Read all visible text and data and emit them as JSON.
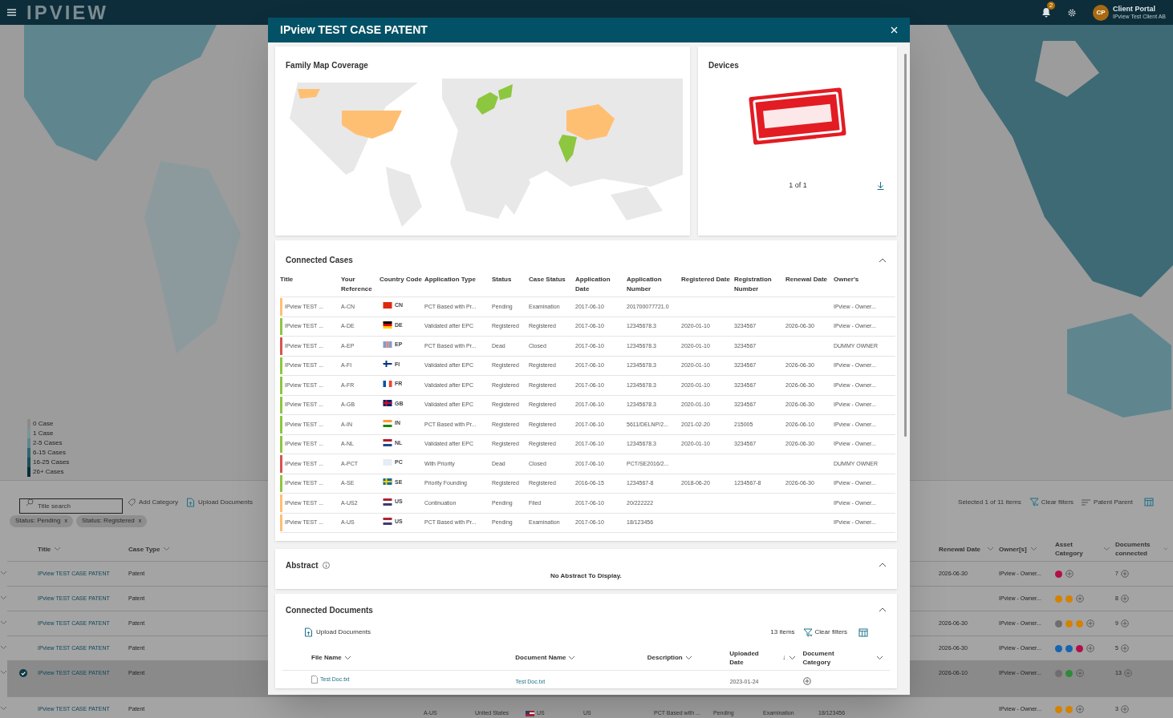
{
  "topbar": {
    "logo": "IPVIEW",
    "notification_count": "2",
    "avatar": "CP",
    "portal_title": "Client Portal",
    "client_name": "IPview Test Client AB"
  },
  "map_legend": [
    {
      "label": "0 Case",
      "color": "#8a8a8a"
    },
    {
      "label": "1 Case",
      "color": "#7d9398"
    },
    {
      "label": "2-5 Cases",
      "color": "#5f868e"
    },
    {
      "label": "6-15 Cases",
      "color": "#2f6470"
    },
    {
      "label": "16-25 Cases",
      "color": "#1a4d5a"
    },
    {
      "label": "26+ Cases",
      "color": "#062e38"
    }
  ],
  "toolbar": {
    "search_placeholder": "Title search",
    "add_category": "Add Category",
    "upload": "Upload Documents",
    "selection": "Selected 1 of 11 items",
    "clear_filters": "Clear filters",
    "view": "Patent Parent"
  },
  "filter_chips": [
    {
      "label": "Status: Pending",
      "remove": "x"
    },
    {
      "label": "Status: Registered",
      "remove": "x"
    }
  ],
  "case_table": {
    "columns": [
      "Title",
      "Case Type",
      "Renewal Date",
      "Owner[s]",
      "Asset Category",
      "Documents connected"
    ],
    "rows": [
      {
        "title": "IPview TEST CASE PATENT",
        "case_type": "Patent",
        "renewal_date": "2026-06-30",
        "owners": "IPview - Owner...",
        "asset_categories": [
          {
            "color": "#b0104a"
          }
        ],
        "documents": "7",
        "selected": false
      },
      {
        "title": "IPview TEST CASE PATENT",
        "case_type": "Patent",
        "owners": "IPview - Owner...",
        "asset_categories": [
          {
            "color": "#d48200"
          },
          {
            "color": "#d48200"
          }
        ],
        "documents": "8",
        "selected": false
      },
      {
        "title": "IPview TEST CASE PATENT",
        "case_type": "Patent",
        "renewal_date": "2026-06-30",
        "owners": "IPview - Owner...",
        "asset_categories": [
          {
            "color": "#6e6e6e"
          },
          {
            "color": "#d48200"
          },
          {
            "color": "#d48200"
          }
        ],
        "documents": "9",
        "selected": false
      },
      {
        "title": "IPview TEST CASE PATENT",
        "case_type": "Patent",
        "renewal_date": "2026-06-30",
        "owners": "IPview - Owner...",
        "asset_categories": [
          {
            "color": "#1565b0"
          },
          {
            "color": "#1565b0"
          },
          {
            "color": "#b0104a"
          }
        ],
        "documents": "5",
        "selected": false
      },
      {
        "title": "IPview TEST CASE PATENT",
        "case_type": "Patent",
        "renewal_date": "2026-06-10",
        "owners": "IPview - Owner...",
        "asset_categories": [
          {
            "color": "#6e6e6e"
          },
          {
            "color": "#2e8b3a"
          }
        ],
        "documents": "13",
        "selected": true
      },
      {
        "title": "IPview TEST CASE PATENT",
        "case_type": "Patent",
        "owners": "IPview - Owner...",
        "asset_categories": [
          {
            "color": "#d48200"
          },
          {
            "color": "#d48200"
          }
        ],
        "documents": "3",
        "selected": false,
        "middle_cells": [
          "A-US",
          "United States",
          "US",
          "US",
          "PCT Based with ...",
          "Pending",
          "Examination",
          "18/123456"
        ]
      }
    ]
  },
  "dialog": {
    "title": "IPview TEST CASE PATENT",
    "family_map": {
      "title": "Family Map Coverage"
    },
    "devices": {
      "title": "Devices",
      "pager": "1 of 1"
    },
    "connected_cases": {
      "title": "Connected Cases",
      "expanded": true,
      "columns": [
        "Title",
        "Your Reference",
        "Country Code",
        "Application Type",
        "Status",
        "Case Status",
        "Application Date",
        "Application Number",
        "Registered Date",
        "Registration Number",
        "Renewal Date",
        "Owner's"
      ],
      "rows": [
        {
          "color": "#ffbf73",
          "title": "IPview TEST ...",
          "reference": "A-CN",
          "flag": {
            "kind": "plain",
            "stripes": [
              {
                "color": "#de2910"
              }
            ]
          },
          "country": "CN",
          "application_type": "PCT Based with Pr...",
          "status": "Pending",
          "case_status": "Examination",
          "application_date": "2017-06-10",
          "application_number": "201700077721.0",
          "owner": "IPview - Owner..."
        },
        {
          "color": "#8dc63f",
          "title": "IPview TEST ...",
          "reference": "A-DE",
          "flag": {
            "kind": "h",
            "stripes": [
              {
                "color": "#000000"
              },
              {
                "color": "#dd0000"
              },
              {
                "color": "#ffce00"
              }
            ]
          },
          "country": "DE",
          "application_type": "Validated after EPC",
          "status": "Registered",
          "case_status": "Registered",
          "application_date": "2017-06-10",
          "application_number": "12345678.3",
          "registered_date": "2020-01-10",
          "registration_number": "3234567",
          "renewal_date": "2026-06-30",
          "owner": "IPview - Owner..."
        },
        {
          "color": "#d9534f",
          "title": "IPview TEST ...",
          "reference": "A-EP",
          "flag": {
            "kind": "v",
            "stripes": [
              {
                "color": "#7f9ec9"
              },
              {
                "color": "#d98a8a"
              },
              {
                "color": "#7f9ec9"
              }
            ]
          },
          "country": "EP",
          "application_type": "PCT Based with Pr...",
          "status": "Dead",
          "case_status": "Closed",
          "application_date": "2017-06-10",
          "application_number": "12345678.3",
          "registered_date": "2020-01-10",
          "registration_number": "3234567",
          "owner": "DUMMY OWNER"
        },
        {
          "color": "#8dc63f",
          "title": "IPview TEST ...",
          "reference": "A-FI",
          "flag": {
            "kind": "cross",
            "stripes": [
              {
                "color": "#ffffff"
              },
              {
                "color": "#003580"
              }
            ]
          },
          "country": "FI",
          "application_type": "Validated after EPC",
          "status": "Registered",
          "case_status": "Registered",
          "application_date": "2017-06-10",
          "application_number": "12345678.3",
          "registered_date": "2020-01-10",
          "registration_number": "3234567",
          "renewal_date": "2026-06-30",
          "owner": "IPview - Owner..."
        },
        {
          "color": "#8dc63f",
          "title": "IPview TEST ...",
          "reference": "A-FR",
          "flag": {
            "kind": "v",
            "stripes": [
              {
                "color": "#0055a4"
              },
              {
                "color": "#ffffff"
              },
              {
                "color": "#ef4135"
              }
            ]
          },
          "country": "FR",
          "application_type": "Validated after EPC",
          "status": "Registered",
          "case_status": "Registered",
          "application_date": "2017-06-10",
          "application_number": "12345678.3",
          "registered_date": "2020-01-10",
          "registration_number": "3234567",
          "renewal_date": "2026-06-30",
          "owner": "IPview - Owner..."
        },
        {
          "color": "#8dc63f",
          "title": "IPview TEST ...",
          "reference": "A-GB",
          "flag": {
            "kind": "cross",
            "stripes": [
              {
                "color": "#012169"
              },
              {
                "color": "#c8102e"
              }
            ]
          },
          "country": "GB",
          "application_type": "Validated after EPC",
          "status": "Registered",
          "case_status": "Registered",
          "application_date": "2017-06-10",
          "application_number": "12345678.3",
          "registered_date": "2020-01-10",
          "registration_number": "3234567",
          "renewal_date": "2026-06-30",
          "owner": "IPview - Owner..."
        },
        {
          "color": "#8dc63f",
          "title": "IPview TEST ...",
          "reference": "A-IN",
          "flag": {
            "kind": "h",
            "stripes": [
              {
                "color": "#ff9933"
              },
              {
                "color": "#ffffff"
              },
              {
                "color": "#138808"
              }
            ]
          },
          "country": "IN",
          "application_type": "PCT Based with Pr...",
          "status": "Registered",
          "case_status": "Registered",
          "application_date": "2017-06-10",
          "application_number": "5611/DELNP/2...",
          "registered_date": "2021-02-20",
          "registration_number": "215005",
          "renewal_date": "2026-06-10",
          "owner": "IPview - Owner..."
        },
        {
          "color": "#8dc63f",
          "title": "IPview TEST ...",
          "reference": "A-NL",
          "flag": {
            "kind": "h",
            "stripes": [
              {
                "color": "#ae1c28"
              },
              {
                "color": "#ffffff"
              },
              {
                "color": "#21468b"
              }
            ]
          },
          "country": "NL",
          "application_type": "Validated after EPC",
          "status": "Registered",
          "case_status": "Registered",
          "application_date": "2017-06-10",
          "application_number": "12345678.3",
          "registered_date": "2020-01-10",
          "registration_number": "3234567",
          "renewal_date": "2026-06-30",
          "owner": "IPview - Owner..."
        },
        {
          "color": "#d9534f",
          "title": "IPview TEST ...",
          "reference": "A-PCT",
          "flag": {
            "kind": "plain",
            "stripes": [
              {
                "color": "#e4ecf4"
              }
            ]
          },
          "country": "PC",
          "application_type": "With Priority",
          "status": "Dead",
          "case_status": "Closed",
          "application_date": "2017-06-10",
          "application_number": "PCT/SE2016/2...",
          "owner": "DUMMY OWNER"
        },
        {
          "color": "#8dc63f",
          "title": "IPview TEST ...",
          "reference": "A-SE",
          "flag": {
            "kind": "cross",
            "stripes": [
              {
                "color": "#006aa7"
              },
              {
                "color": "#fecc00"
              }
            ]
          },
          "country": "SE",
          "application_type": "Priority Founding",
          "status": "Registered",
          "case_status": "Registered",
          "application_date": "2016-06-15",
          "application_number": "1234567-8",
          "registered_date": "2018-06-20",
          "registration_number": "1234567-8",
          "renewal_date": "2026-06-30",
          "owner": "IPview - Owner..."
        },
        {
          "color": "#ffbf73",
          "title": "IPview TEST ...",
          "reference": "A-US2",
          "flag": {
            "kind": "h",
            "stripes": [
              {
                "color": "#b22234"
              },
              {
                "color": "#ffffff"
              },
              {
                "color": "#3c3b6e"
              }
            ]
          },
          "country": "US",
          "application_type": "Continuation",
          "status": "Pending",
          "case_status": "Filed",
          "application_date": "2017-06-10",
          "application_number": "20/222222",
          "owner": "IPview - Owner..."
        },
        {
          "color": "#ffbf73",
          "title": "IPview TEST ...",
          "reference": "A-US",
          "flag": {
            "kind": "h",
            "stripes": [
              {
                "color": "#b22234"
              },
              {
                "color": "#ffffff"
              },
              {
                "color": "#3c3b6e"
              }
            ]
          },
          "country": "US",
          "application_type": "PCT Based with Pr...",
          "status": "Pending",
          "case_status": "Examination",
          "application_date": "2017-06-10",
          "application_number": "18/123456",
          "owner": "IPview - Owner..."
        }
      ]
    },
    "abstract": {
      "title": "Abstract",
      "expanded": true,
      "empty_text": "No Abstract To Display."
    },
    "connected_documents": {
      "title": "Connected Documents",
      "expanded": true,
      "upload": "Upload Documents",
      "count": "13 items",
      "clear_filters": "Clear filters",
      "columns": [
        {
          "label": "File Name"
        },
        {
          "label": "Document Name"
        },
        {
          "label": "Description"
        },
        {
          "label": "Uploaded Date",
          "sort": "↓"
        },
        {
          "label": "Document Category"
        }
      ],
      "rows": [
        {
          "file_name": "Test Doc.txt",
          "document_name": "Test Doc.txt",
          "uploaded_date": "2023-01-24"
        }
      ]
    }
  }
}
